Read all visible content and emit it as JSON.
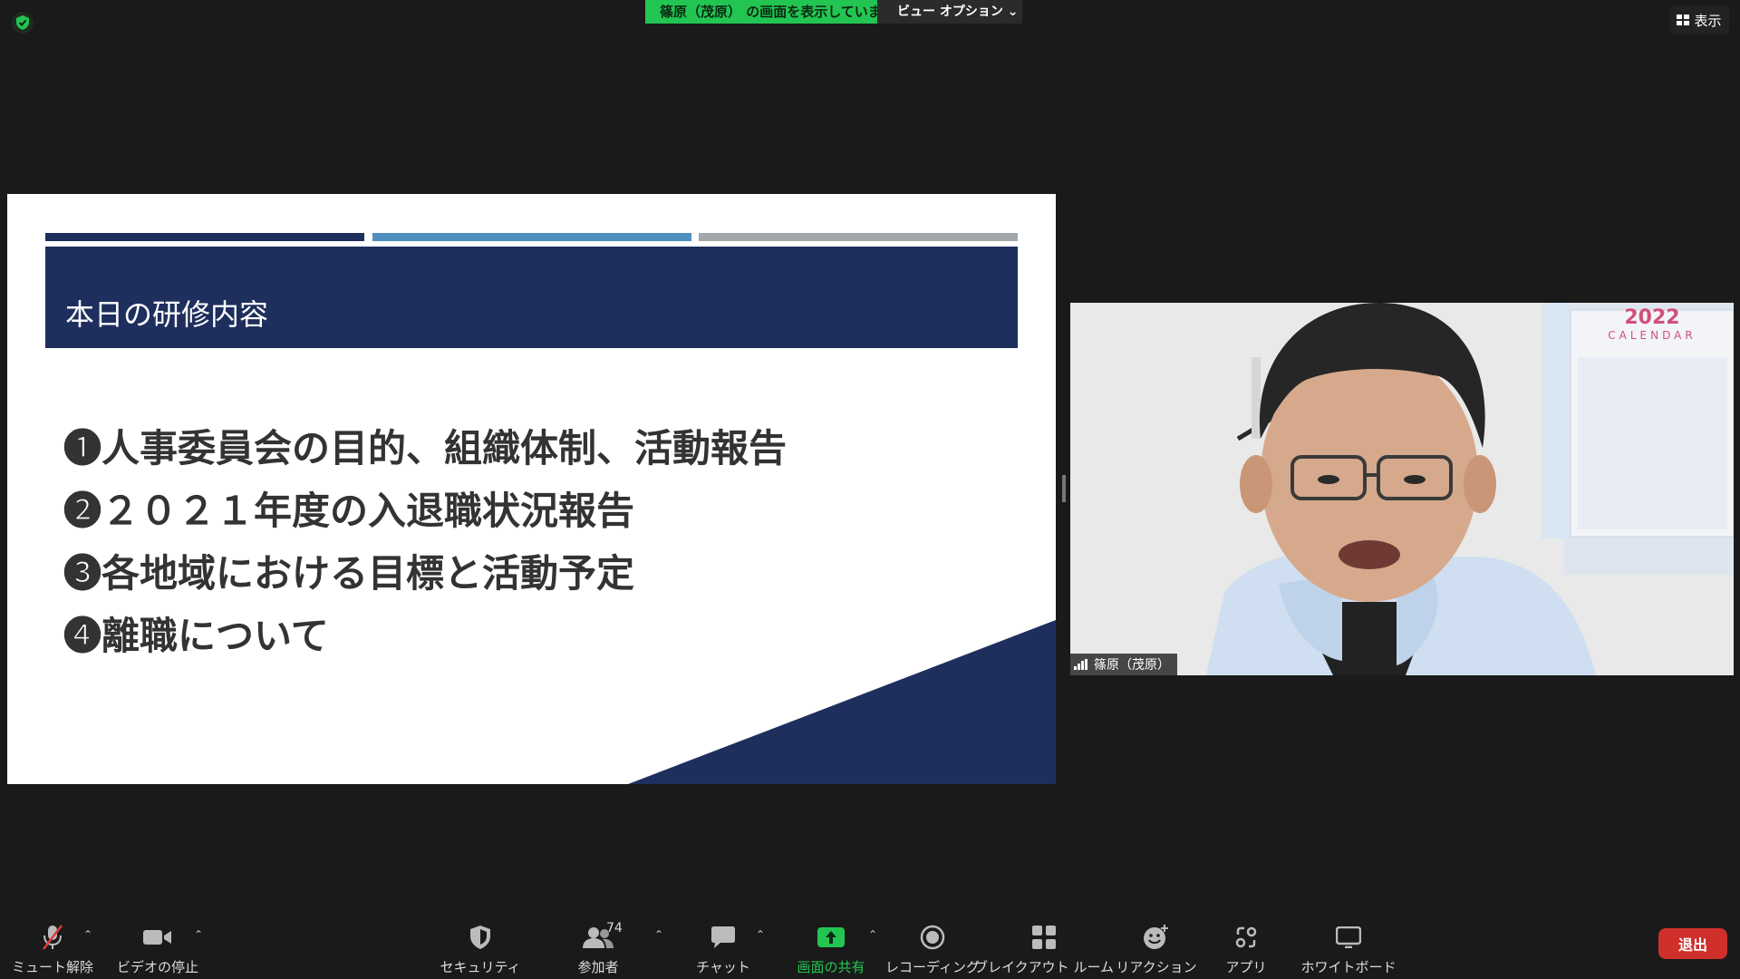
{
  "topbar": {
    "sharing_text": "篠原（茂原） の画面を表示しています",
    "view_options": "ビュー オプション ⌄",
    "display_label": "表示"
  },
  "slide": {
    "title": "本日の研修内容",
    "items": [
      "❶人事委員会の目的、組織体制、活動報告",
      "❷２０２１年度の入退職状況報告",
      "❸各地域における目標と活動予定",
      "❹離職について"
    ],
    "colors": {
      "navy": "#1e2f5e",
      "blue": "#4f8fbe",
      "gray": "#a3a6ab"
    }
  },
  "video": {
    "participant_name": "篠原（茂原）",
    "calendar_year": "2022",
    "calendar_word": "CALENDAR"
  },
  "toolbar": {
    "mute": "ミュート解除",
    "video": "ビデオの停止",
    "security": "セキュリティ",
    "participants": "参加者",
    "participants_count": "74",
    "chat": "チャット",
    "share": "画面の共有",
    "recording": "レコーディング",
    "breakout": "ブレイクアウト ルーム",
    "reaction": "リアクション",
    "apps": "アプリ",
    "whiteboard": "ホワイトボード",
    "leave": "退出"
  },
  "accent_colors": {
    "green": "#23c552",
    "leave_red": "#d0302b"
  }
}
